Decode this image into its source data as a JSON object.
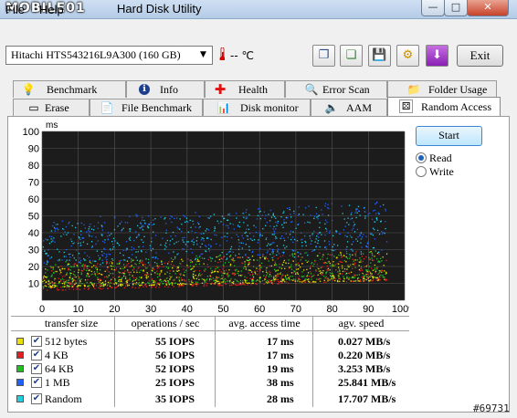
{
  "window": {
    "watermark_logo": "MOBILE01",
    "title": "Hard Disk Utility",
    "min_glyph": "—",
    "max_glyph": "□",
    "close_glyph": "✕"
  },
  "menu": {
    "file": "File",
    "help": "Help"
  },
  "toolbar": {
    "drive": "Hitachi HTS543216L9A300 (160 GB)",
    "temperature": "-- ℃",
    "exit": "Exit",
    "icons": [
      "copy-info-icon",
      "copy-screen-icon",
      "save-icon",
      "options-icon",
      "download-icon"
    ]
  },
  "tabs_row1": [
    {
      "label": "Benchmark",
      "icon": "bulb-icon",
      "glyph": "💡"
    },
    {
      "label": "Info",
      "icon": "info-icon",
      "glyph": "ℹ"
    },
    {
      "label": "Health",
      "icon": "health-cross-icon",
      "glyph": "✚"
    },
    {
      "label": "Error Scan",
      "icon": "magnifier-icon",
      "glyph": "🔍"
    },
    {
      "label": "Folder Usage",
      "icon": "folder-icon",
      "glyph": "📁"
    }
  ],
  "tabs_row2": [
    {
      "label": "Erase",
      "icon": "erase-icon",
      "glyph": "▭"
    },
    {
      "label": "File Benchmark",
      "icon": "file-icon",
      "glyph": "📄"
    },
    {
      "label": "Disk monitor",
      "icon": "chart-icon",
      "glyph": "📊"
    },
    {
      "label": "AAM",
      "icon": "speaker-icon",
      "glyph": "🔈"
    },
    {
      "label": "Random Access",
      "icon": "dice-icon",
      "glyph": "⚄",
      "active": true
    }
  ],
  "controls": {
    "start": "Start",
    "read": "Read",
    "write": "Write",
    "selected": "Read"
  },
  "colors": {
    "plot_bg": "#1c1c1c",
    "grid": "#555555",
    "512 bytes": "#e8e000",
    "4 KB": "#e02020",
    "64 KB": "#20c020",
    "1 MB": "#2060ff",
    "Random": "#20d0e0"
  },
  "chart_data": {
    "type": "scatter",
    "y_unit_label": "ms",
    "xlim": [
      0,
      100
    ],
    "ylim": [
      0,
      100
    ],
    "x_ticks": [
      "0",
      "10",
      "20",
      "30",
      "40",
      "50",
      "60",
      "70",
      "80",
      "90",
      "100%"
    ],
    "y_ticks": [
      "100",
      "90",
      "80",
      "70",
      "60",
      "50",
      "40",
      "30",
      "20",
      "10"
    ],
    "grid": true,
    "series": [
      {
        "name": "512 bytes",
        "color": "#e8e000",
        "y_band_start": [
          8,
          22
        ],
        "y_band_end": [
          12,
          30
        ]
      },
      {
        "name": "4 KB",
        "color": "#e02020",
        "y_band_start": [
          6,
          22
        ],
        "y_band_end": [
          12,
          30
        ]
      },
      {
        "name": "64 KB",
        "color": "#20c020",
        "y_band_start": [
          8,
          24
        ],
        "y_band_end": [
          14,
          30
        ]
      },
      {
        "name": "1 MB",
        "color": "#2060ff",
        "y_band_start": [
          22,
          48
        ],
        "y_band_end": [
          30,
          60
        ]
      },
      {
        "name": "Random",
        "color": "#20d0e0",
        "y_band_start": [
          20,
          45
        ],
        "y_band_end": [
          28,
          58
        ]
      }
    ]
  },
  "table": {
    "headers": [
      "transfer size",
      "operations / sec",
      "avg. access time",
      "agv. speed"
    ],
    "rows": [
      {
        "name": "512 bytes",
        "color": "#e8e000",
        "checked": true,
        "ops": "55 IOPS",
        "access": "17 ms",
        "speed": "0.027 MB/s"
      },
      {
        "name": "4 KB",
        "color": "#e02020",
        "checked": true,
        "ops": "56 IOPS",
        "access": "17 ms",
        "speed": "0.220 MB/s"
      },
      {
        "name": "64 KB",
        "color": "#20c020",
        "checked": true,
        "ops": "52 IOPS",
        "access": "19 ms",
        "speed": "3.253 MB/s"
      },
      {
        "name": "1 MB",
        "color": "#2060ff",
        "checked": true,
        "ops": "25 IOPS",
        "access": "38 ms",
        "speed": "25.841 MB/s"
      },
      {
        "name": "Random",
        "color": "#20d0e0",
        "checked": true,
        "ops": "35 IOPS",
        "access": "28 ms",
        "speed": "17.707 MB/s"
      }
    ]
  },
  "watermark_id": "#69731"
}
